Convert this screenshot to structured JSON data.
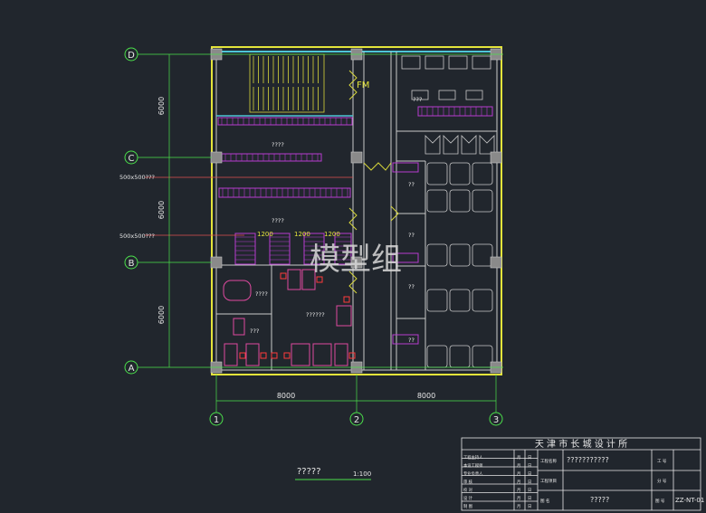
{
  "drawing": {
    "grid_rows": [
      {
        "id": "D"
      },
      {
        "id": "C"
      },
      {
        "id": "B"
      },
      {
        "id": "A"
      }
    ],
    "grid_cols": [
      {
        "id": "1"
      },
      {
        "id": "2"
      },
      {
        "id": "3"
      }
    ],
    "dims_vertical": [
      "6000",
      "6000",
      "6000"
    ],
    "dims_horizontal": [
      "8000",
      "8000"
    ],
    "room_labels": [
      "????",
      "????",
      "????",
      "??????",
      "???",
      "???",
      "??",
      "??",
      "??",
      "??"
    ],
    "duct_notes": [
      "500x500???",
      "500x500???"
    ],
    "duct_widths": [
      "1200",
      "1200",
      "1200"
    ],
    "fm_label": "FM",
    "watermark": "模型组",
    "scale_caption": "?????",
    "scale_value": "1:100"
  },
  "title_block": {
    "company": "天 津 市 长 城 设 计 所",
    "rows": [
      {
        "role": "工程主持人",
        "c1": "月",
        "c2": "日"
      },
      {
        "role": "本设工程师",
        "c1": "月",
        "c2": "日"
      },
      {
        "role": "专业负责人",
        "c1": "月",
        "c2": "日"
      },
      {
        "role": "审  核",
        "c1": "月",
        "c2": "日"
      },
      {
        "role": "校  对",
        "c1": "月",
        "c2": "日"
      },
      {
        "role": "设  计",
        "c1": "月",
        "c2": "日"
      },
      {
        "role": "制  图",
        "c1": "月",
        "c2": "日"
      }
    ],
    "project_label": "工程名称",
    "project_value": "???????????",
    "sub_label": "工程项目",
    "drawing_label": "图  名",
    "drawing_value": "?????",
    "job_label": "工  号",
    "phase_label": "分  号",
    "sheet_label": "图  号",
    "sheet_value": "ZZ-NT-01"
  },
  "colors": {
    "background": "#21262d",
    "wall": "#c9c9c9",
    "column": "#8a8a8a",
    "outer_wall": "#e4e43a",
    "duct": "#b83cd0",
    "equipment": "#e04aa0",
    "dim_line": "#3bd13b",
    "axis_line": "#e05050",
    "bubble": "#4be04b",
    "stair": "#d8d83a",
    "text": "#e8e8e8",
    "accent_cyan": "#4ec5d6"
  }
}
